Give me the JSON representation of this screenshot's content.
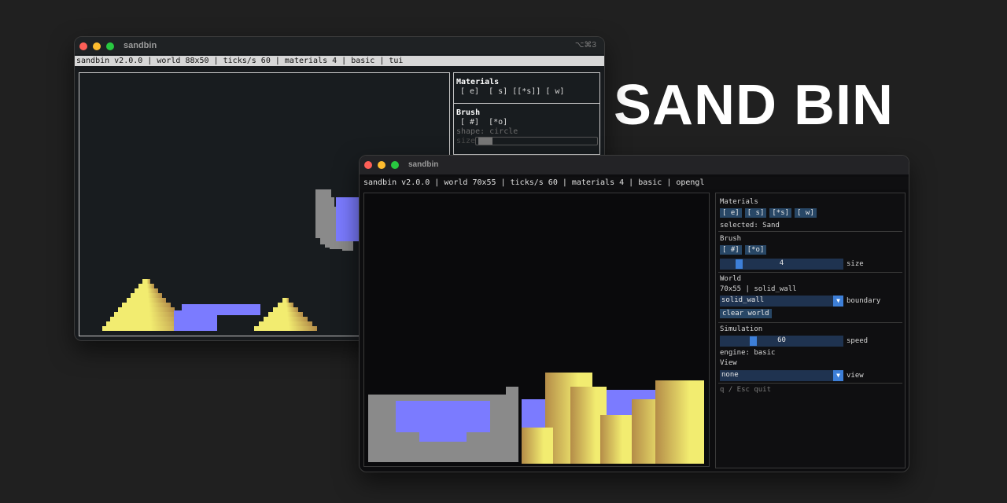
{
  "hero_title": "SAND BIN",
  "tui": {
    "window_title": "sandbin",
    "shortcut": "⌥⌘3",
    "status": "sandbin v2.0.0 | world 88x50 | ticks/s 60 | materials 4 | basic | tui",
    "materials_label": "Materials",
    "materials_line": "[ e]  [ s] [[*s]] [ w]",
    "brush_label": "Brush",
    "brush_line": "[ #]  [*o]",
    "shape_line": "shape: circle",
    "size_label": "size"
  },
  "gl": {
    "window_title": "sandbin",
    "status": "sandbin v2.0.0 | world 70x55 | ticks/s 60 | materials 4 | basic | opengl",
    "materials_label": "Materials",
    "material_buttons": [
      "[ e]",
      "[ s]",
      "[*s]",
      "[ w]"
    ],
    "selected": "selected: Sand",
    "brush_label": "Brush",
    "brush_buttons": [
      "[ #]",
      "[*o]"
    ],
    "brush_size": "4",
    "size_label": "size",
    "world_label": "World",
    "world_info": "70x55 | solid_wall",
    "boundary_value": "solid_wall",
    "boundary_label": "boundary",
    "clear_label": "clear world",
    "simulation_label": "Simulation",
    "speed_value": "60",
    "speed_label": "speed",
    "engine": "engine: basic",
    "view_label": "View",
    "view_value": "none",
    "view_side": "view",
    "quit_hint": "q / Esc quit"
  },
  "colors": {
    "sand": "#f2ec70",
    "sand_dark": "#b48c48",
    "water": "#7b7bff",
    "wall": "#8a8a8a",
    "accent": "#3d7fd8"
  }
}
